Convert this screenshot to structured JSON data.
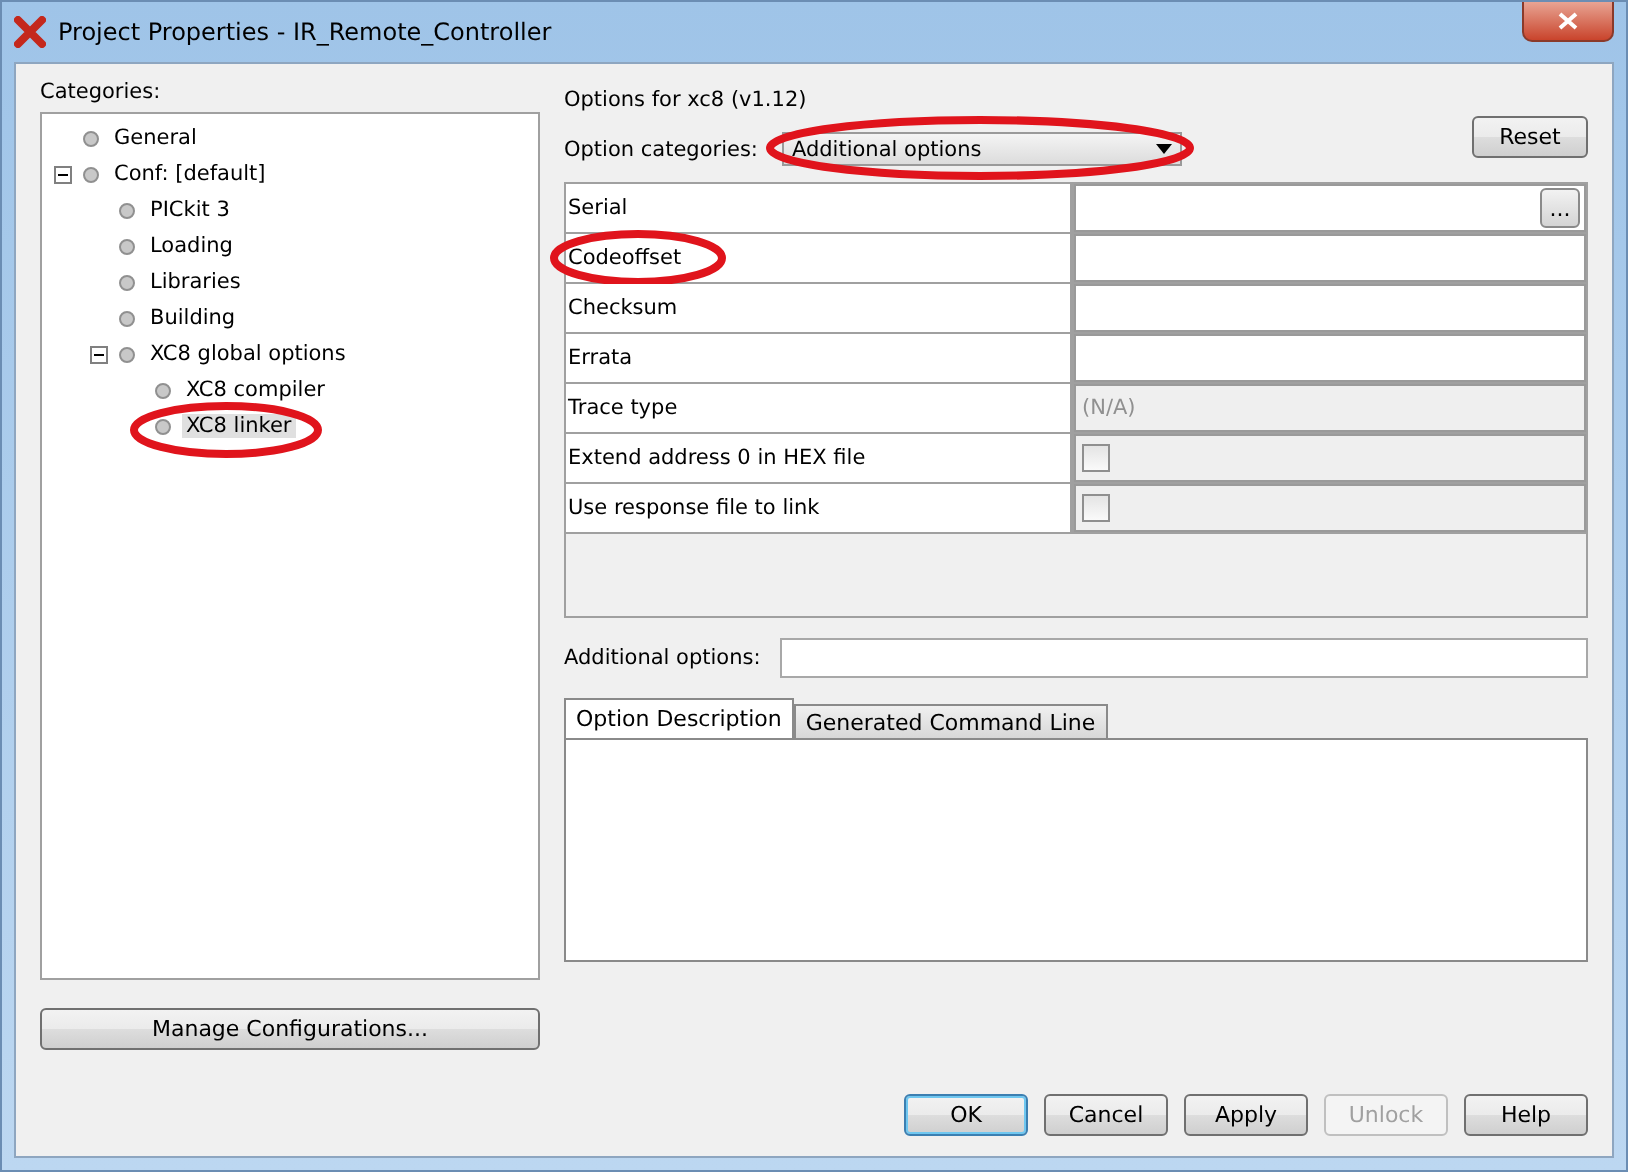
{
  "window": {
    "title": "Project Properties - IR_Remote_Controller"
  },
  "categories": {
    "label": "Categories:",
    "tree": [
      {
        "label": "General",
        "selected": false,
        "circled": false
      },
      {
        "label": "Conf: [default]",
        "selected": false,
        "circled": false,
        "expanded": true,
        "children": [
          {
            "label": "PICkit 3",
            "selected": false,
            "circled": false
          },
          {
            "label": "Loading",
            "selected": false,
            "circled": false
          },
          {
            "label": "Libraries",
            "selected": false,
            "circled": false
          },
          {
            "label": "Building",
            "selected": false,
            "circled": false
          },
          {
            "label": "XC8 global options",
            "selected": false,
            "circled": false,
            "expanded": true,
            "children": [
              {
                "label": "XC8 compiler",
                "selected": false,
                "circled": false
              },
              {
                "label": "XC8 linker",
                "selected": true,
                "circled": true
              }
            ]
          }
        ]
      }
    ]
  },
  "manage_button": "Manage Configurations...",
  "options_title": "Options for xc8 (v1.12)",
  "option_categories": {
    "label": "Option categories:",
    "value": "Additional options",
    "circled": true
  },
  "reset_button": "Reset",
  "properties": [
    {
      "name": "Serial",
      "kind": "browse",
      "button": "...",
      "circled": false
    },
    {
      "name": "Codeoffset",
      "kind": "text",
      "circled": true
    },
    {
      "name": "Checksum",
      "kind": "text",
      "circled": false
    },
    {
      "name": "Errata",
      "kind": "text",
      "circled": false
    },
    {
      "name": "Trace type",
      "kind": "disabled",
      "value": "(N/A)",
      "circled": false
    },
    {
      "name": "Extend address 0 in HEX file",
      "kind": "checkbox",
      "checked": false,
      "circled": false
    },
    {
      "name": "Use response file to link",
      "kind": "checkbox",
      "checked": false,
      "circled": false
    }
  ],
  "additional_options": {
    "label": "Additional options:"
  },
  "tabs": [
    {
      "label": "Option Description",
      "selected": true
    },
    {
      "label": "Generated Command Line",
      "selected": false
    }
  ],
  "buttons": [
    {
      "label": "OK",
      "default": true,
      "disabled": false
    },
    {
      "label": "Cancel",
      "default": false,
      "disabled": false
    },
    {
      "label": "Apply",
      "default": false,
      "disabled": false
    },
    {
      "label": "Unlock",
      "default": false,
      "disabled": true
    },
    {
      "label": "Help",
      "default": false,
      "disabled": false
    }
  ]
}
